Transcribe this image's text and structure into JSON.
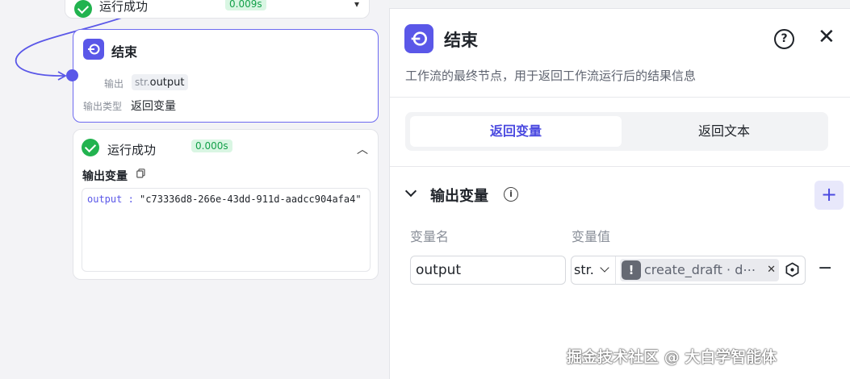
{
  "canvas": {
    "prev_node": {
      "status": "运行成功",
      "time": "0.009s"
    },
    "end_node": {
      "title": "结束",
      "output_label": "输出",
      "output_type_prefix": "str.",
      "output_name": "output",
      "output_type_label": "输出类型",
      "output_type_value": "返回变量"
    },
    "result_card": {
      "status": "运行成功",
      "time": "0.000s",
      "output_title": "输出变量",
      "output_key": "output",
      "output_sep": " : ",
      "output_value": "\"c73336d8-266e-43dd-911d-aadcc904afa4\""
    }
  },
  "panel": {
    "title": "结束",
    "description": "工作流的最终节点，用于返回工作流运行后的结果信息",
    "tabs": [
      {
        "label": "返回变量",
        "active": true
      },
      {
        "label": "返回文本",
        "active": false
      }
    ],
    "section_title": "输出变量",
    "column_name": "变量名",
    "column_value": "变量值",
    "row": {
      "name": "output",
      "type": "str.",
      "reference": "create_draft · d⋯"
    }
  },
  "watermark": "掘金技术社区 @ 大白学智能体",
  "colors": {
    "accent": "#5a57e8",
    "success": "#22b34f",
    "success_badge_bg": "#d9f6e3"
  },
  "icons": {
    "end_node": "end-node-icon",
    "check": "check-circle-icon",
    "help": "help-icon",
    "close": "close-icon",
    "info": "info-icon",
    "add": "plus-icon",
    "warning": "warning-icon",
    "copy": "copy-icon",
    "var_picker": "variable-picker-icon",
    "remove": "minus-icon"
  }
}
